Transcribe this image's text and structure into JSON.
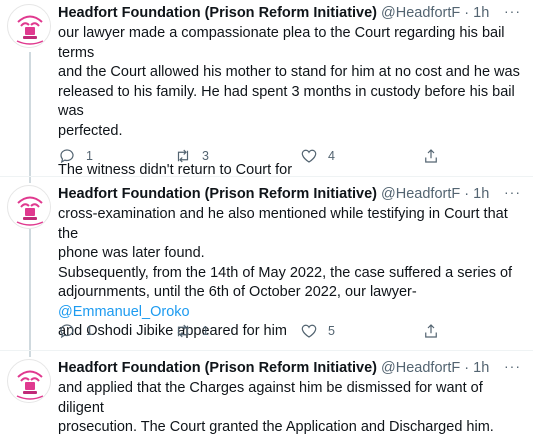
{
  "colors": {
    "accent": "#1d9bf0",
    "muted": "#536471",
    "text": "#0f1419",
    "avatar_pink": "#e0398f"
  },
  "tweets": [
    {
      "name": "Headfort Foundation (Prison Reform Initiative)",
      "handle": "@HeadfortF",
      "sep": "·",
      "time": "1h",
      "more": "···",
      "lines": [
        "our lawyer made a compassionate plea to the Court regarding his bail terms",
        "and the Court allowed his mother to stand for him at no cost and he was",
        "released to his family. He had spent 3 months in custody before his bail was",
        "perfected.",
        "",
        "The witness didn't return to Court for"
      ],
      "replies": "1",
      "retweets": "3",
      "likes": "4"
    },
    {
      "name": "Headfort Foundation (Prison Reform Initiative)",
      "handle": "@HeadfortF",
      "sep": "·",
      "time": "1h",
      "more": "···",
      "lines": [
        "cross-examination and he also mentioned while testifying in Court that the",
        "phone was later found.",
        "Subsequently, from the 14th of May 2022, the case suffered a series of",
        "adjournments, until the 6th of October 2022, our lawyer-"
      ],
      "mention": "@Emmanuel_Oroko",
      "last_line": "and Oshodi Jibike appeared for him",
      "replies": "1",
      "retweets": "1",
      "likes": "5"
    },
    {
      "name": "Headfort Foundation (Prison Reform Initiative)",
      "handle": "@HeadfortF",
      "sep": "·",
      "time": "1h",
      "more": "···",
      "lines": [
        "and applied that the Charges against him be dismissed for want of diligent",
        "prosecution. The Court granted the Application and Discharged him."
      ]
    }
  ]
}
